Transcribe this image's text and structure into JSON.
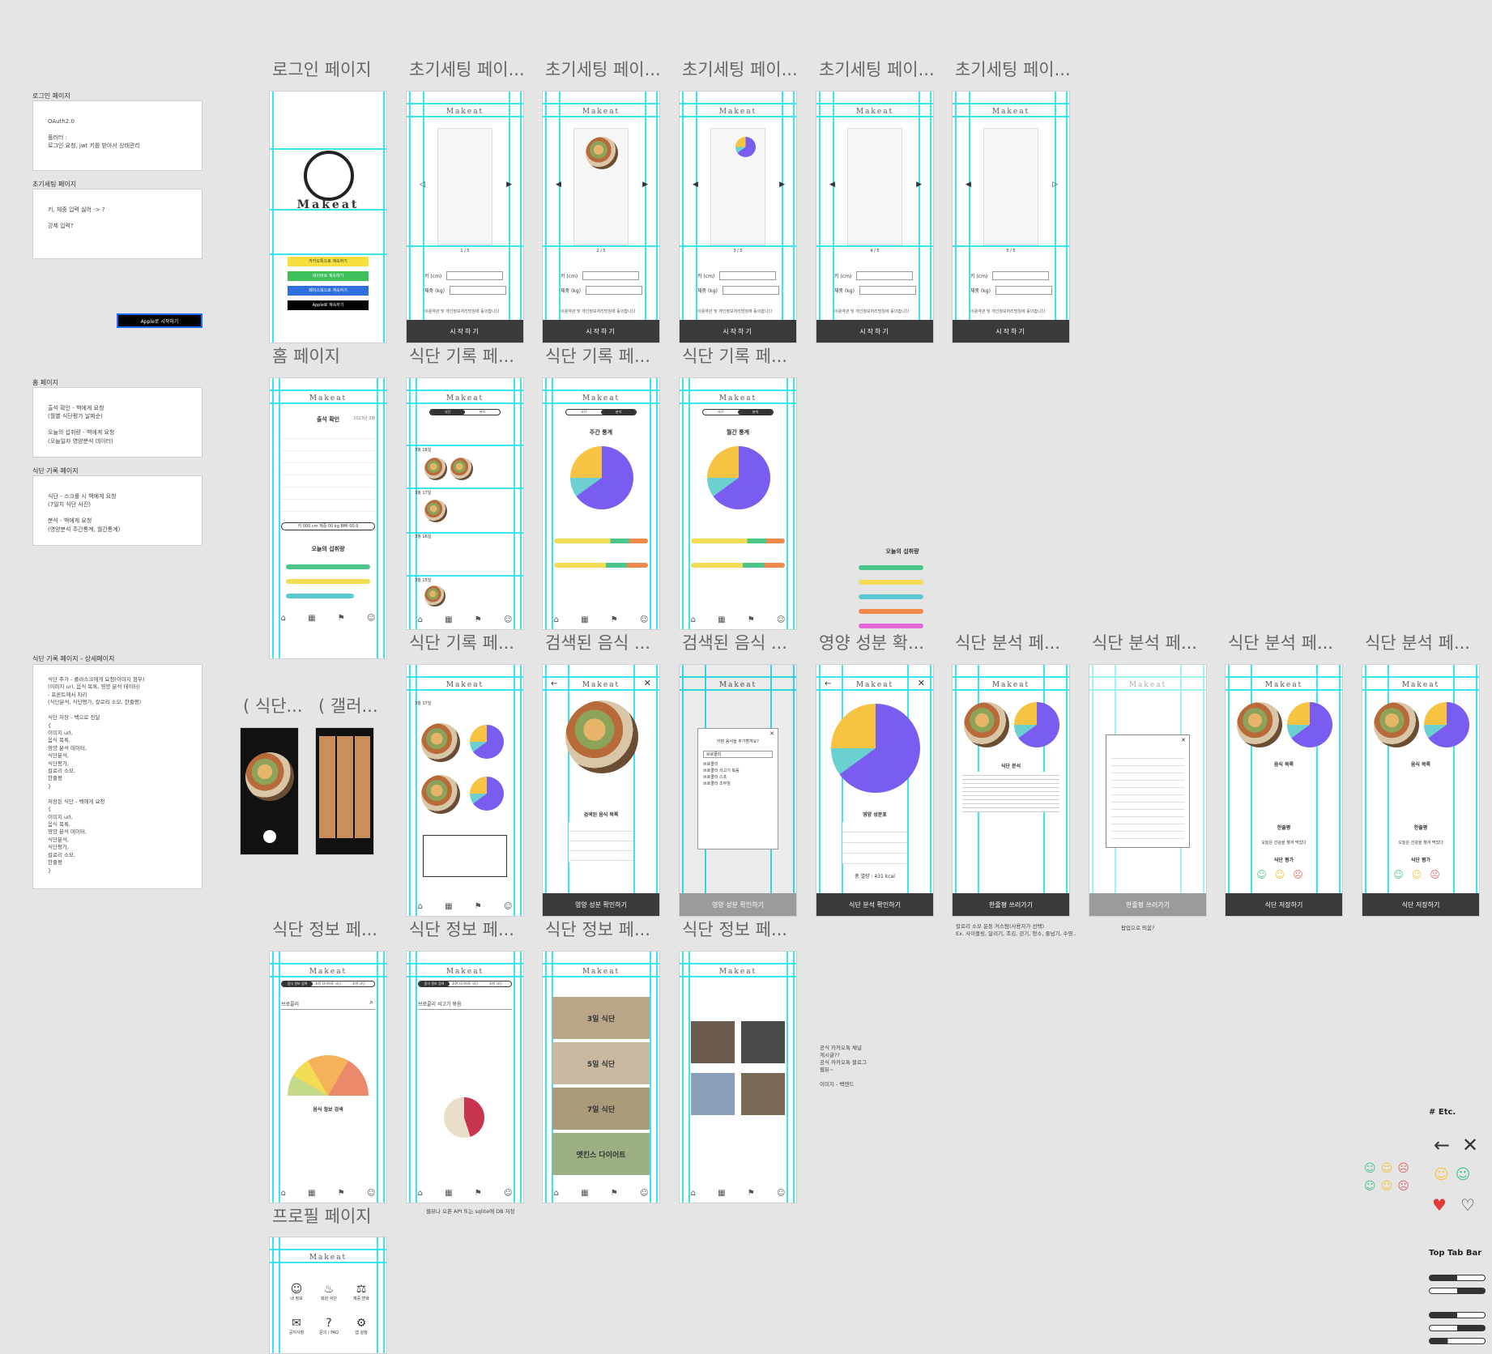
{
  "notes": [
    {
      "label": "로그인 페이지",
      "text": "OAuth2.0\n\n플러터 :\n로그인 요청, jwt 키를 받아서 상태관리"
    },
    {
      "label": "초기세팅 페이지",
      "text": "키, 체중 입력 싫어 -> ?\n\n강제 입력?"
    },
    {
      "label": "홈 페이지",
      "text": "출석 확인 - 백에게 요청\n(월별 식단평가 날짜순)\n\n오늘의 섭취량 - 백에게 요청\n(오늘일자 영양분석 데이터)"
    },
    {
      "label": "식단 기록 페이지",
      "text": "식단 - 스크롤 시 백에게 요청\n(7일치 식단 사진)\n\n분석 - 백에게 요청\n(영양분석 주간통계, 월간통계)"
    },
    {
      "label": "식단 기록 페이지 - 상세페이지",
      "text": "식단 추가 - 플라스크에게 요청(이미지 첨부)\n(이미지 url, 음식 목록, 영양 분석 데이터)\n- 프론트에서 처리\n(식단분석, 식단평가, 칼로리 소모, 한줄평)\n\n식단 저장 - 백으로 전달\n{\n이미지 url,\n음식 목록,\n영양 분석 데이터,\n식단분석,\n식단평가,\n칼로리 소모,\n한줄평\n}\n\n저장된 식단 - 백에게 요청\n{\n이미지 url,\n음식 목록,\n영양 분석 데이터,\n식단분석,\n식단평가,\n칼로리 소모,\n한줄평\n}"
    }
  ],
  "apple_button": "Apple로 시작하기",
  "frame_titles": {
    "row1": [
      "로그인 페이지",
      "초기세팅 페이...",
      "초기세팅 페이...",
      "초기세팅 페이...",
      "초기세팅 페이...",
      "초기세팅 페이..."
    ],
    "row2": [
      "홈 페이지",
      "식단 기록 페...",
      "식단 기록 페...",
      "식단 기록 페..."
    ],
    "row3": [
      "식단 기록 페...",
      "검색된 음식 ...",
      "검색된 음식 ...",
      "영양 성분 확...",
      "식단 분석 페...",
      "식단 분석 페...",
      "식단 분석 페...",
      "식단 분석 페..."
    ],
    "row4": [
      "식단 정보 페...",
      "식단 정보 페...",
      "식단 정보 페...",
      "식단 정보 페..."
    ],
    "row5": [
      "프로필 페이지"
    ],
    "side": [
      "( 식단...",
      "( 갤러..."
    ]
  },
  "app": {
    "logo": "Makeat",
    "start_cta": "시작하기",
    "height_label": "키 (cm)",
    "weight_label": "체중 (kg)",
    "agree": "이용약관 및 개인정보처리방침에 동의합니다",
    "pages": [
      "1 / 5",
      "2 / 5",
      "3 / 5",
      "4 / 5",
      "5 / 5"
    ],
    "login_buttons": [
      "카카오톡으로 계속하기",
      "네이버로 계속하기",
      "페이스북으로 계속하기",
      "Apple로 계속하기"
    ],
    "home_title": "출석 확인",
    "home_month": "2023년 3월",
    "home_body": "키 000 cm  체중 00 kg  BMI 00.0",
    "today_intake": "오늘의 섭취량",
    "nutrients": [
      "칼로리",
      "탄수화물",
      "단백질",
      "지방"
    ],
    "weekly": "주간 통계",
    "monthly": "월간 통계",
    "tabs_diet": [
      "식단",
      "분석"
    ],
    "pct": [
      "17%",
      "10%",
      "65%"
    ],
    "searched_foods": "검색된 음식 목록",
    "check_nutrition": "영양 성분 확인하기",
    "nutrition_title": "영양 성분표",
    "total_kcal": "총 열량 : 431 kcal",
    "diet_analysis": "식단 분석",
    "check_analysis": "식단 분석 확인하기",
    "write_review": "한줄평 쓰러가기",
    "save_diet": "식단 저장하기",
    "food_list": "음식 목록",
    "review": "한줄평",
    "review_text": "오늘은 건강을 챙겨 먹었다",
    "eval": "식단 평가",
    "dates": [
      "3월 18일",
      "3월 17일",
      "3월 16일",
      "3월 15일"
    ],
    "search_popup": "어떤 음식을 추가할까요?",
    "search_query": "브로콜리",
    "search_results": [
      "브로콜리",
      "브로콜리 쇠고기 볶음",
      "브로콜리 스프",
      "브로콜리 조무침"
    ],
    "calorie_note": "칼로리 소모 운동 커스텀(사용자가 선택)\nEx. 사이클링, 달리기, 조깅, 걷기, 청소, 줄넘기, 수영..",
    "popup_note": "팝업으로 띄움?",
    "info_tabs": [
      "음식 정보 검색",
      "추천 다이어트 식단",
      "추천 식단"
    ],
    "info_search_title": "음식 정보 검색",
    "info_dish": "브로콜리 쇠고기 볶음",
    "diet_plans": [
      "3일 식단",
      "5일 식단",
      "7일 식단",
      "앳킨스 다이어트"
    ],
    "api_note": "웹뷰나 오픈 API 또는 sqlite에 DB 저장",
    "extra_note": "공식 카카오톡 채널\n게시글??\n공식 카카오톡 블로그\n웹뷰~\n\n이미지 - 백엔드",
    "profile_menu": [
      "내 정보",
      "회원 식단",
      "체중 변화",
      "공지사항",
      "문의 / FAQ",
      "앱 설정"
    ],
    "tabbar": [
      "홈",
      "식단 기록",
      "식단 정보",
      "프로필"
    ]
  },
  "etc": {
    "title": "# Etc.",
    "top_tab": "Top Tab Bar"
  },
  "colors": {
    "grid": "#22e3f0",
    "pie_main": "#7b5cf0",
    "pie_teal": "#6ccfd0",
    "pie_yellow": "#f6c343",
    "kakao": "#f7e03c",
    "naver": "#3fbf5a",
    "facebook": "#2f6fe0",
    "cta": "#3a3a3a"
  }
}
